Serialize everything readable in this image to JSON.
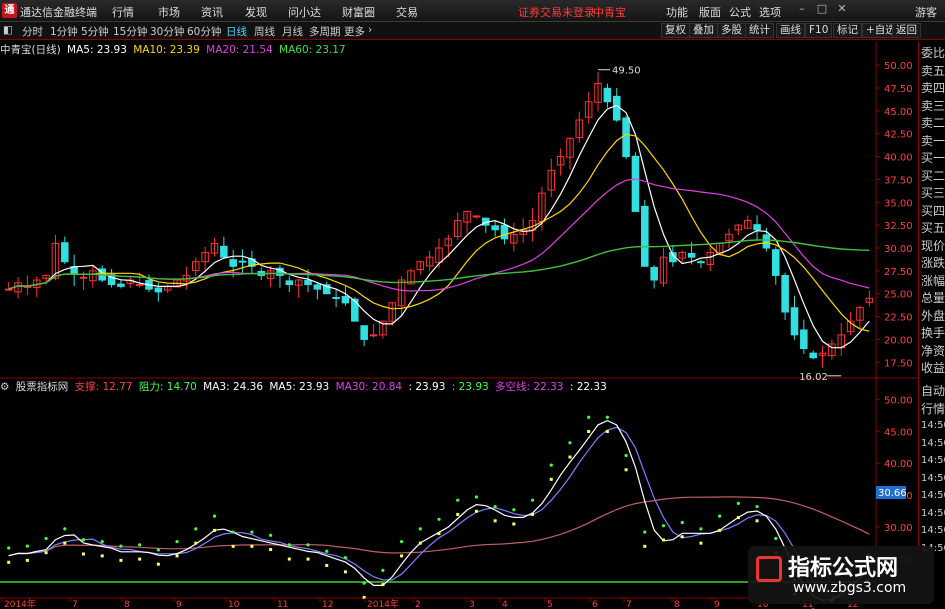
{
  "app": {
    "name": "通达信金融终端",
    "logo": "通"
  },
  "menu": [
    "行情",
    "市场",
    "资讯",
    "发现",
    "问小达",
    "财富圈",
    "交易"
  ],
  "alert": "证券交易未登录",
  "product": "中青宝",
  "right_menu": [
    "功能",
    "版面",
    "公式",
    "选项"
  ],
  "guest": "游客",
  "toolbar": {
    "periods": [
      "分时",
      "1分钟",
      "5分钟",
      "15分钟",
      "30分钟",
      "60分钟",
      "日线",
      "周线",
      "月线",
      "多周期",
      "更多"
    ],
    "active": "日线",
    "right": [
      "复权",
      "叠加",
      "多股",
      "统计",
      "画线",
      "F10",
      "标记",
      "+自选",
      "返回"
    ]
  },
  "main_legend": {
    "title": "中青宝(日线)",
    "items": [
      {
        "label": "MA5: 23.93",
        "color": "#ffffff"
      },
      {
        "label": "MA10: 23.39",
        "color": "#ffd700"
      },
      {
        "label": "MA20: 21.54",
        "color": "#e040e0"
      },
      {
        "label": "MA60: 23.17",
        "color": "#40e040"
      }
    ]
  },
  "sub_legend": {
    "title": "股票指标网",
    "items": [
      {
        "label": "支撑: 12.77",
        "color": "#ff4040"
      },
      {
        "label": "阻力: 14.70",
        "color": "#40ff40"
      },
      {
        "label": "MA3: 24.36",
        "color": "#ffffff"
      },
      {
        "label": "MA5: 23.93",
        "color": "#ffffff"
      },
      {
        "label": "MA30: 20.84",
        "color": "#e040e0"
      },
      {
        "label": ": 23.93",
        "color": "#ffffff"
      },
      {
        "label": ": 23.93",
        "color": "#40ff40"
      },
      {
        "label": "多空线: 22.33",
        "color": "#e040e0"
      },
      {
        "label": ": 22.33",
        "color": "#ffffff"
      }
    ]
  },
  "side_tabs": [
    "委比",
    "卖五",
    "卖四",
    "卖三",
    "卖二",
    "卖一",
    "买一",
    "买二",
    "买三",
    "买四",
    "买五",
    "现价",
    "涨跌",
    "涨幅",
    "总量",
    "外盘",
    "换手",
    "净资",
    "收益"
  ],
  "side_tabs2": [
    "自动",
    "行情",
    "14:50",
    "14:50",
    "14:50",
    "14:50",
    "14:50",
    "14:50",
    "14:50",
    "14:50"
  ],
  "annotations": {
    "high": "49.50",
    "low": "16.02",
    "value_badge": "30.66"
  },
  "x_axis": [
    "2014年",
    "7",
    "8",
    "9",
    "10",
    "11",
    "12",
    "2014年",
    "2",
    "3",
    "4",
    "5",
    "6",
    "7",
    "8",
    "9",
    "10",
    "11",
    "12"
  ],
  "watermark": {
    "title": "指标公式网",
    "url": "www.zbgs3.com"
  },
  "chart_data": [
    {
      "type": "candlestick",
      "title": "中青宝(日线)",
      "y_ticks": [
        "50.00",
        "47.50",
        "45.00",
        "42.50",
        "40.00",
        "37.50",
        "35.00",
        "32.50",
        "30.00",
        "27.50",
        "25.00",
        "22.50",
        "20.00",
        "17.50"
      ],
      "ylim": [
        16,
        51
      ],
      "close": [
        25.5,
        26.2,
        25.8,
        26.5,
        27.0,
        30.5,
        28.5,
        27.2,
        26.8,
        27.5,
        26.5,
        26.0,
        25.8,
        26.5,
        26.0,
        25.5,
        25.2,
        25.8,
        26.5,
        27.0,
        28.5,
        29.5,
        30.5,
        29.0,
        28.0,
        28.5,
        28.0,
        27.0,
        27.5,
        27.0,
        26.0,
        26.5,
        26.0,
        25.5,
        25.0,
        24.5,
        24.0,
        22.0,
        20.0,
        20.5,
        22.0,
        24.0,
        26.5,
        27.5,
        28.5,
        29.0,
        30.0,
        31.0,
        33.0,
        34.0,
        33.5,
        32.5,
        32.0,
        31.0,
        31.5,
        32.0,
        33.0,
        36.0,
        38.5,
        40.0,
        42.0,
        44.0,
        46.0,
        48.0,
        46.0,
        44.0,
        40.0,
        34.0,
        28.0,
        26.5,
        29.0,
        28.5,
        29.5,
        29.0,
        28.5,
        29.5,
        30.5,
        31.5,
        32.5,
        33.0,
        32.0,
        30.0,
        27.0,
        23.0,
        20.5,
        19.0,
        18.0,
        18.5,
        19.5,
        20.5,
        22.0,
        23.5,
        24.5
      ],
      "series": [
        {
          "name": "MA5"
        },
        {
          "name": "MA10"
        },
        {
          "name": "MA20"
        },
        {
          "name": "MA60"
        }
      ]
    },
    {
      "type": "line",
      "title": "股票指标网",
      "y_ticks": [
        "50.00",
        "45.00",
        "40.00",
        "35.00",
        "30.00",
        "25.00"
      ],
      "ylim": [
        22,
        51
      ]
    }
  ]
}
